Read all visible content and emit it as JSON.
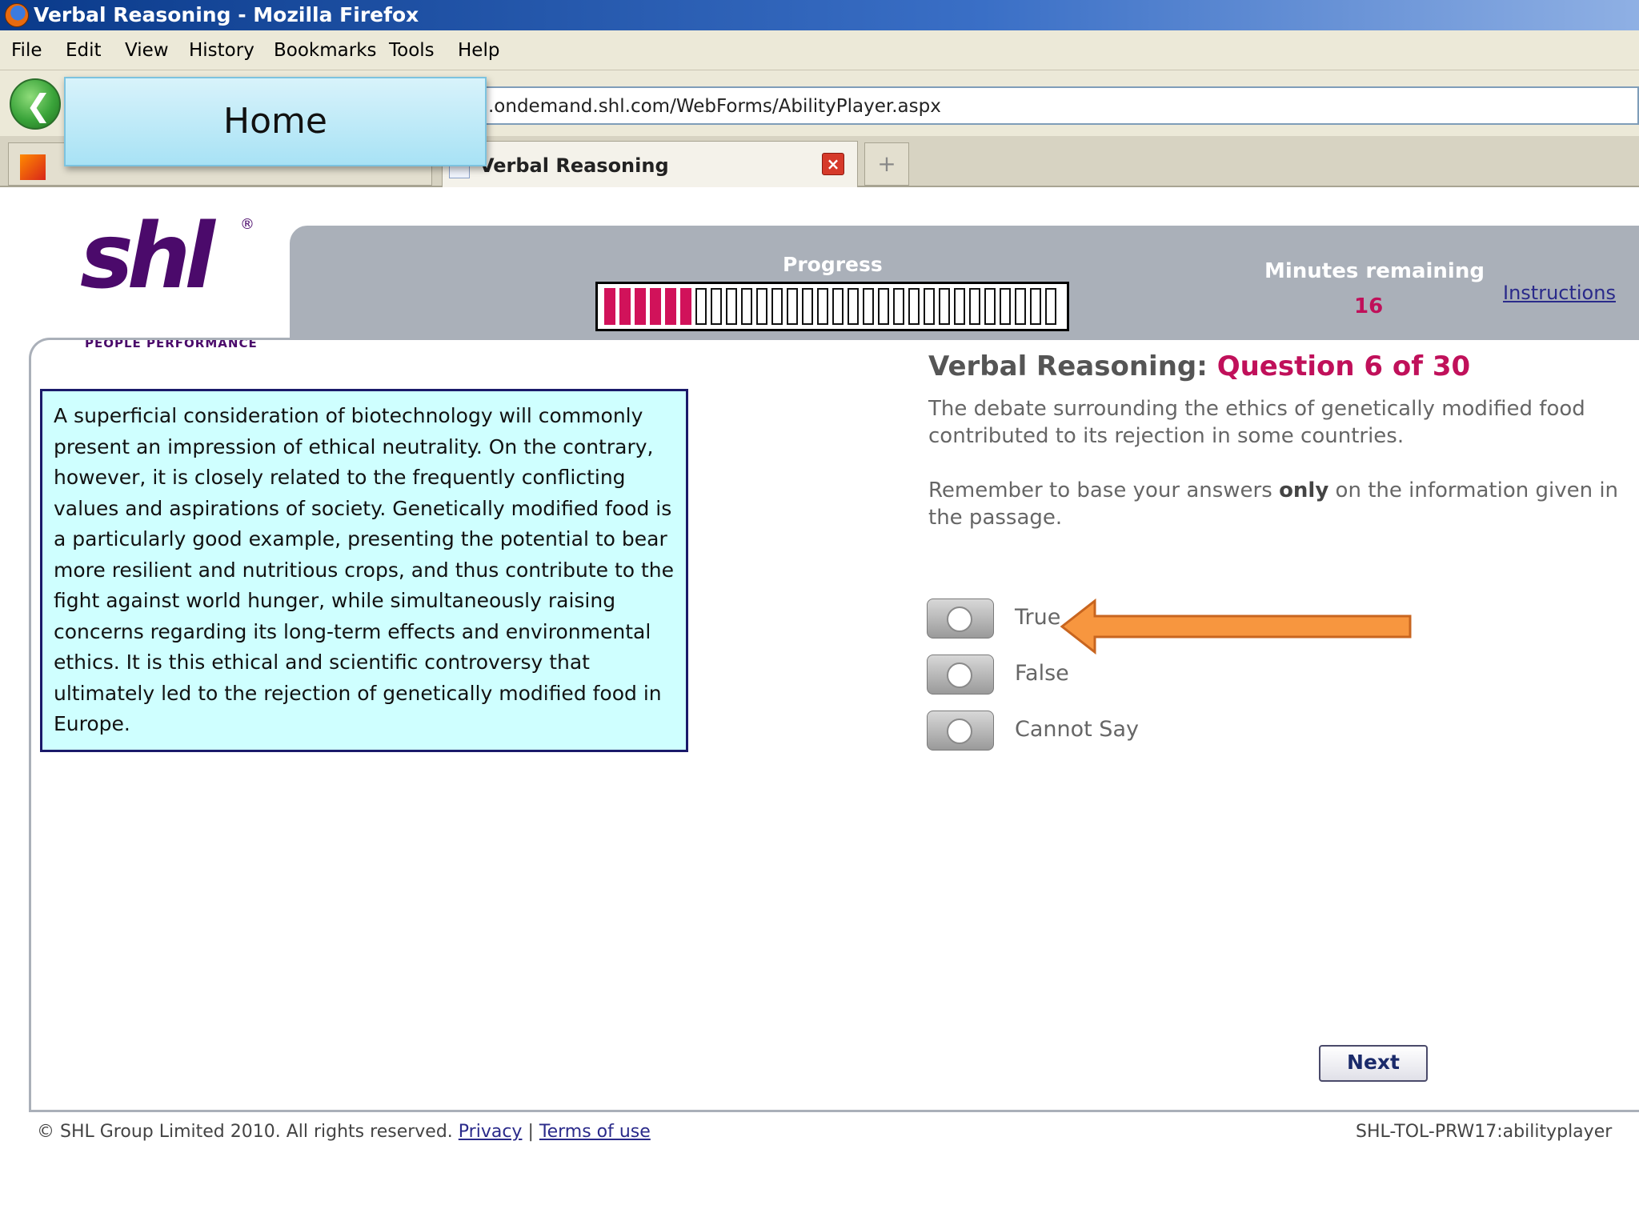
{
  "window": {
    "title": "Verbal Reasoning - Mozilla Firefox"
  },
  "menu": {
    "items": [
      "File",
      "Edit",
      "View",
      "History",
      "Bookmarks",
      "Tools",
      "Help"
    ]
  },
  "nav": {
    "url": ".ondemand.shl.com/WebForms/AbilityPlayer.aspx",
    "back_icon": "back-arrow-icon"
  },
  "tabs": [
    {
      "label": "Verbal Reasoning",
      "active": true
    }
  ],
  "overlay": {
    "label": "Home"
  },
  "logo": {
    "wordmark": "shl",
    "registered": "®",
    "tagline": "PEOPLE PERFORMANCE"
  },
  "header": {
    "progress_label": "Progress",
    "progress": {
      "completed": 6,
      "total": 30
    },
    "minutes_label": "Minutes remaining",
    "minutes_value": "16",
    "instructions_link": "Instructions"
  },
  "passage": {
    "text": "A superficial consideration of biotechnology will commonly present an impression of ethical neutrality. On the contrary, however, it is closely related to the frequently conflicting values and aspirations of society. Genetically modified food is a particularly good example, presenting the potential to bear more resilient and nutritious crops, and thus contribute to the fight against world hunger, while simultaneously raising concerns regarding its long-term effects and environmental ethics. It is this ethical and scientific controversy that ultimately led to the rejection of genetically modified food in Europe."
  },
  "question": {
    "title_prefix": "Verbal Reasoning:",
    "number_text": "Question 6 of 30",
    "statement": "The debate surrounding the ethics of genetically modified food contributed to its rejection in some countries.",
    "reminder_pre": "Remember to base your answers ",
    "reminder_bold": "only",
    "reminder_post": " on the information given in the passage.",
    "options": [
      "True",
      "False",
      "Cannot Say"
    ]
  },
  "actions": {
    "next_label": "Next"
  },
  "footer": {
    "copyright": "© SHL Group Limited 2010. All rights reserved.",
    "privacy_link": "Privacy",
    "separator": "|",
    "terms_link": "Terms of use",
    "build_id": "SHL-TOL-PRW17:abilityplayer"
  },
  "colors": {
    "accent_pink": "#c0105a",
    "logo_purple": "#4b0a6b",
    "header_gray": "#aab0b9",
    "passage_bg": "#cfffff",
    "arrow_orange": "#f7963f"
  }
}
